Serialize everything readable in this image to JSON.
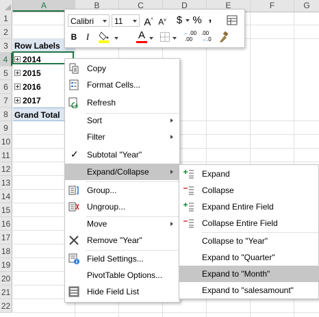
{
  "sheet": {
    "columns": [
      "A",
      "B",
      "C",
      "D",
      "E",
      "F",
      "G"
    ],
    "rows": [
      "1",
      "2",
      "3",
      "4",
      "5",
      "6",
      "7",
      "8",
      "9",
      "10",
      "11",
      "12",
      "13",
      "14",
      "15",
      "16",
      "17",
      "18",
      "19",
      "20",
      "21",
      "22"
    ],
    "selected_column": "A",
    "selected_row": "4"
  },
  "pivot": {
    "row_labels_header": "Row Labels",
    "years": [
      "2014",
      "2015",
      "2016",
      "2017"
    ],
    "grand_total": "Grand Total"
  },
  "mini_toolbar": {
    "font_name": "Calibri",
    "font_size": "11",
    "grow_font": "A",
    "shrink_font": "A",
    "currency": "$",
    "percent": "%",
    "comma": ",",
    "bold": "B",
    "italic": "I",
    "font_color_letter": "A",
    "decimal_increase": ".00",
    "decimal_decrease": ".0",
    "highlight_color": "#ffff00",
    "font_color": "#ff0000"
  },
  "context_menu": {
    "copy": "Copy",
    "format_cells": "Format Cells...",
    "refresh": "Refresh",
    "sort": "Sort",
    "filter": "Filter",
    "subtotal": "Subtotal \"Year\"",
    "expand_collapse": "Expand/Collapse",
    "group": "Group...",
    "ungroup": "Ungroup...",
    "move": "Move",
    "remove": "Remove \"Year\"",
    "field_settings": "Field Settings...",
    "pivot_options": "PivotTable Options...",
    "hide_field_list": "Hide Field List"
  },
  "submenu": {
    "expand": "Expand",
    "collapse": "Collapse",
    "expand_entire": "Expand Entire Field",
    "collapse_entire": "Collapse Entire Field",
    "collapse_to_year": "Collapse to \"Year\"",
    "expand_to_quarter": "Expand to \"Quarter\"",
    "expand_to_month": "Expand to \"Month\"",
    "expand_to_salesamount": "Expand to \"salesamount\""
  }
}
